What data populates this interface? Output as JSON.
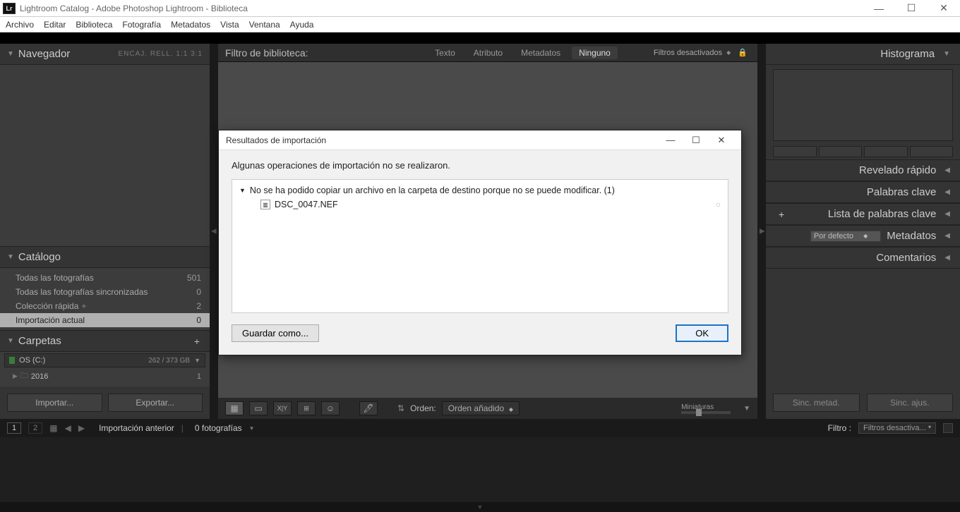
{
  "titlebar": {
    "badge": "Lr",
    "title": "Lightroom Catalog - Adobe Photoshop Lightroom - Biblioteca"
  },
  "menu": [
    "Archivo",
    "Editar",
    "Biblioteca",
    "Fotografía",
    "Metadatos",
    "Vista",
    "Ventana",
    "Ayuda"
  ],
  "left": {
    "navigator": {
      "title": "Navegador",
      "extras": "ENCAJ.   RELL.   1:1   3:1"
    },
    "catalog": {
      "title": "Catálogo",
      "items": [
        {
          "name": "Todas las fotografías",
          "count": "501"
        },
        {
          "name": "Todas las fotografías sincronizadas",
          "count": "0"
        },
        {
          "name": "Colección rápida",
          "count": "2",
          "plus": true
        },
        {
          "name": "Importación actual",
          "count": "0",
          "selected": true
        }
      ]
    },
    "folders": {
      "title": "Carpetas",
      "volume": {
        "name": "OS (C:)",
        "size": "262 / 373 GB"
      },
      "folder": {
        "name": "2016",
        "count": "1"
      }
    },
    "buttons": {
      "import": "Importar...",
      "export": "Exportar..."
    }
  },
  "center": {
    "filter": {
      "title": "Filtro de biblioteca:",
      "tabs": [
        "Texto",
        "Atributo",
        "Metadatos",
        "Ninguno"
      ],
      "selected": 3,
      "dropdown": "Filtros desactivados"
    },
    "toolbar": {
      "order_label": "Orden:",
      "order_value": "Orden añadido",
      "thumb_label": "Miniaturas"
    }
  },
  "right": {
    "histogram": "Histograma",
    "panels": [
      "Revelado rápido",
      "Palabras clave",
      "Lista de palabras clave",
      "Metadatos",
      "Comentarios"
    ],
    "metadata_preset": "Por defecto",
    "sync_meta": "Sinc. metad.",
    "sync_adj": "Sinc. ajus."
  },
  "filmstrip": {
    "source": "Importación anterior",
    "count": "0 fotografías",
    "filter_label": "Filtro :",
    "filter_dd": "Filtros desactiva..."
  },
  "dialog": {
    "title": "Resultados de importación",
    "message": "Algunas operaciones de importación no se realizaron.",
    "group": "No se ha podido copiar un archivo en la carpeta de destino porque no se puede modificar. (1)",
    "file": "DSC_0047.NEF",
    "save_as": "Guardar como...",
    "ok": "OK"
  }
}
